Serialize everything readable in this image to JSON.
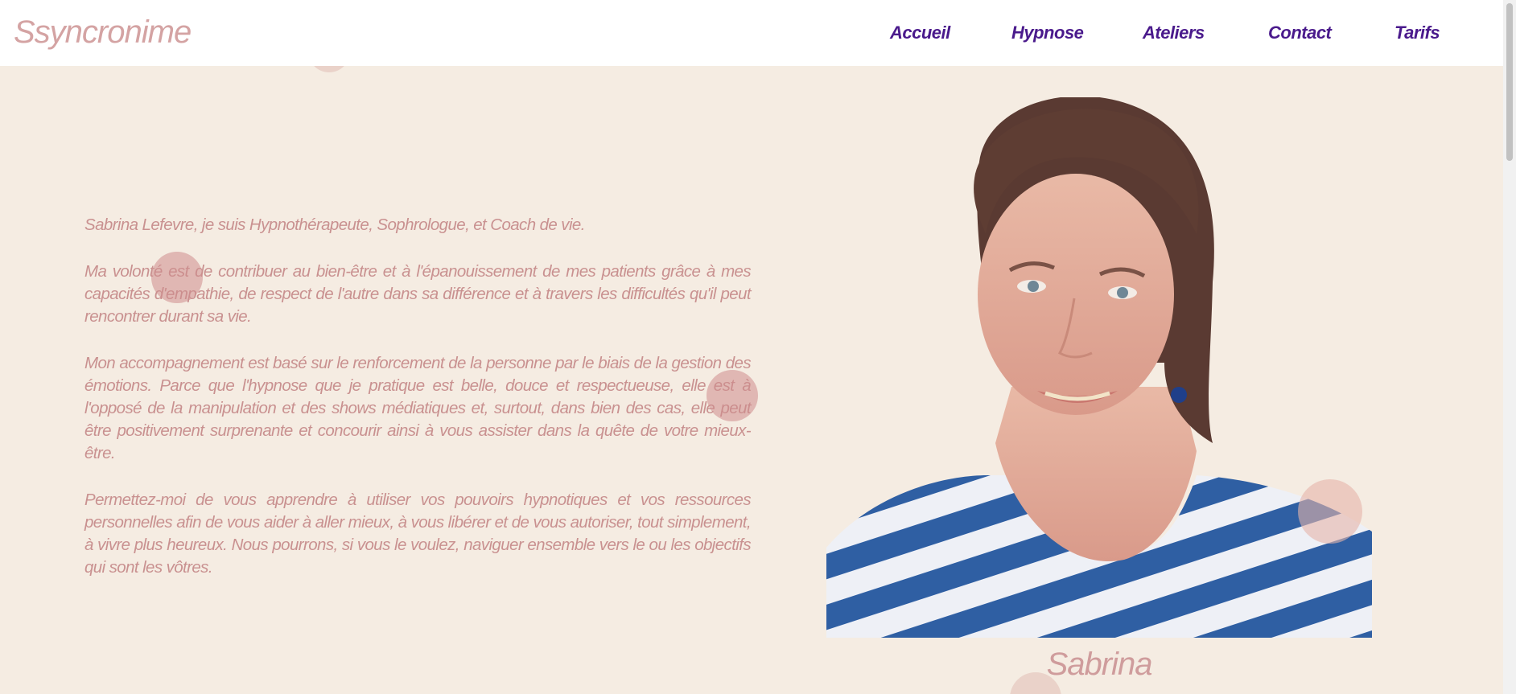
{
  "site": {
    "logo": "Ssyncronime"
  },
  "nav": {
    "items": [
      {
        "label": "Accueil"
      },
      {
        "label": "Hypnose"
      },
      {
        "label": "Ateliers"
      },
      {
        "label": "Contact"
      },
      {
        "label": "Tarifs"
      }
    ]
  },
  "main": {
    "paragraphs": [
      "Sabrina Lefevre, je suis Hypnothérapeute, Sophrologue, et Coach de vie.",
      "Ma volonté est de contribuer au bien-être et à l'épanouissement de mes patients grâce à mes capacités d'empathie, de respect de l'autre dans sa différence et à travers les difficultés qu'il peut rencontrer durant sa vie.",
      "Mon accompagnement est basé sur le renforcement de la personne par le biais de la gestion des émotions.  Parce que l'hypnose que je pratique est belle, douce et respectueuse, elle est à l'opposé de la manipulation et des shows médiatiques et, surtout, dans bien des cas, elle peut être positivement surprenante et concourir ainsi à vous assister dans la quête de votre mieux-être.",
      "Permettez-moi de vous apprendre à utiliser vos pouvoirs hypnotiques et vos ressources personnelles afin de vous aider à aller mieux, à vous libérer et de vous autoriser, tout simplement, à vivre plus heureux.  Nous pourrons, si vous le voulez, naviguer ensemble vers le ou les objectifs qui sont les vôtres."
    ],
    "photo_caption": "Sabrina"
  },
  "colors": {
    "background": "#f5ece2",
    "text": "#c99190",
    "nav": "#4a1a8c",
    "logo": "#d4a3a3"
  }
}
